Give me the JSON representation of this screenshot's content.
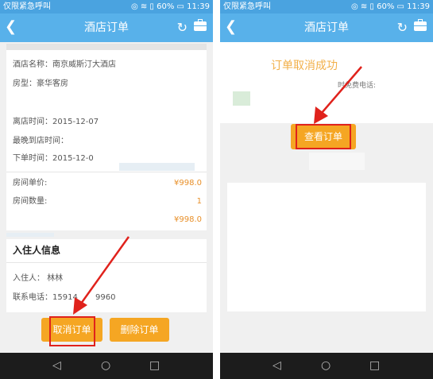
{
  "status": {
    "carrier": "仅限紧急呼叫",
    "battery": "60%",
    "time": "11:39"
  },
  "left": {
    "title": "酒店订单",
    "hotel_name": "酒店名称：南京威斯汀大酒店",
    "room_type": "房型：豪华客房",
    "checkout": "离店时间：2015-12-07",
    "latest_arrival": "最晚到店时间：",
    "order_time": "下单时间：2015-12-0",
    "unit_price_label": "房间单价:",
    "unit_price": "¥998.0",
    "room_count_label": "房间数量:",
    "room_count": "1",
    "total": "¥998.0",
    "guest_section": "入住人信息",
    "guest": "入住人：  林林",
    "phone": "联系电话：15914",
    "phone_tail": "9960",
    "cancel_button": "取消订单",
    "delete_button": "删除订单"
  },
  "right": {
    "title": "酒店订单",
    "success": "订单取消成功",
    "free_call": "时免费电话:",
    "view_button": "查看订单"
  },
  "colors": {
    "nav": "#58b1ea",
    "status": "#4aa3e0",
    "accent": "#f5a623",
    "highlight": "#e0221c",
    "price": "#e8902a"
  }
}
